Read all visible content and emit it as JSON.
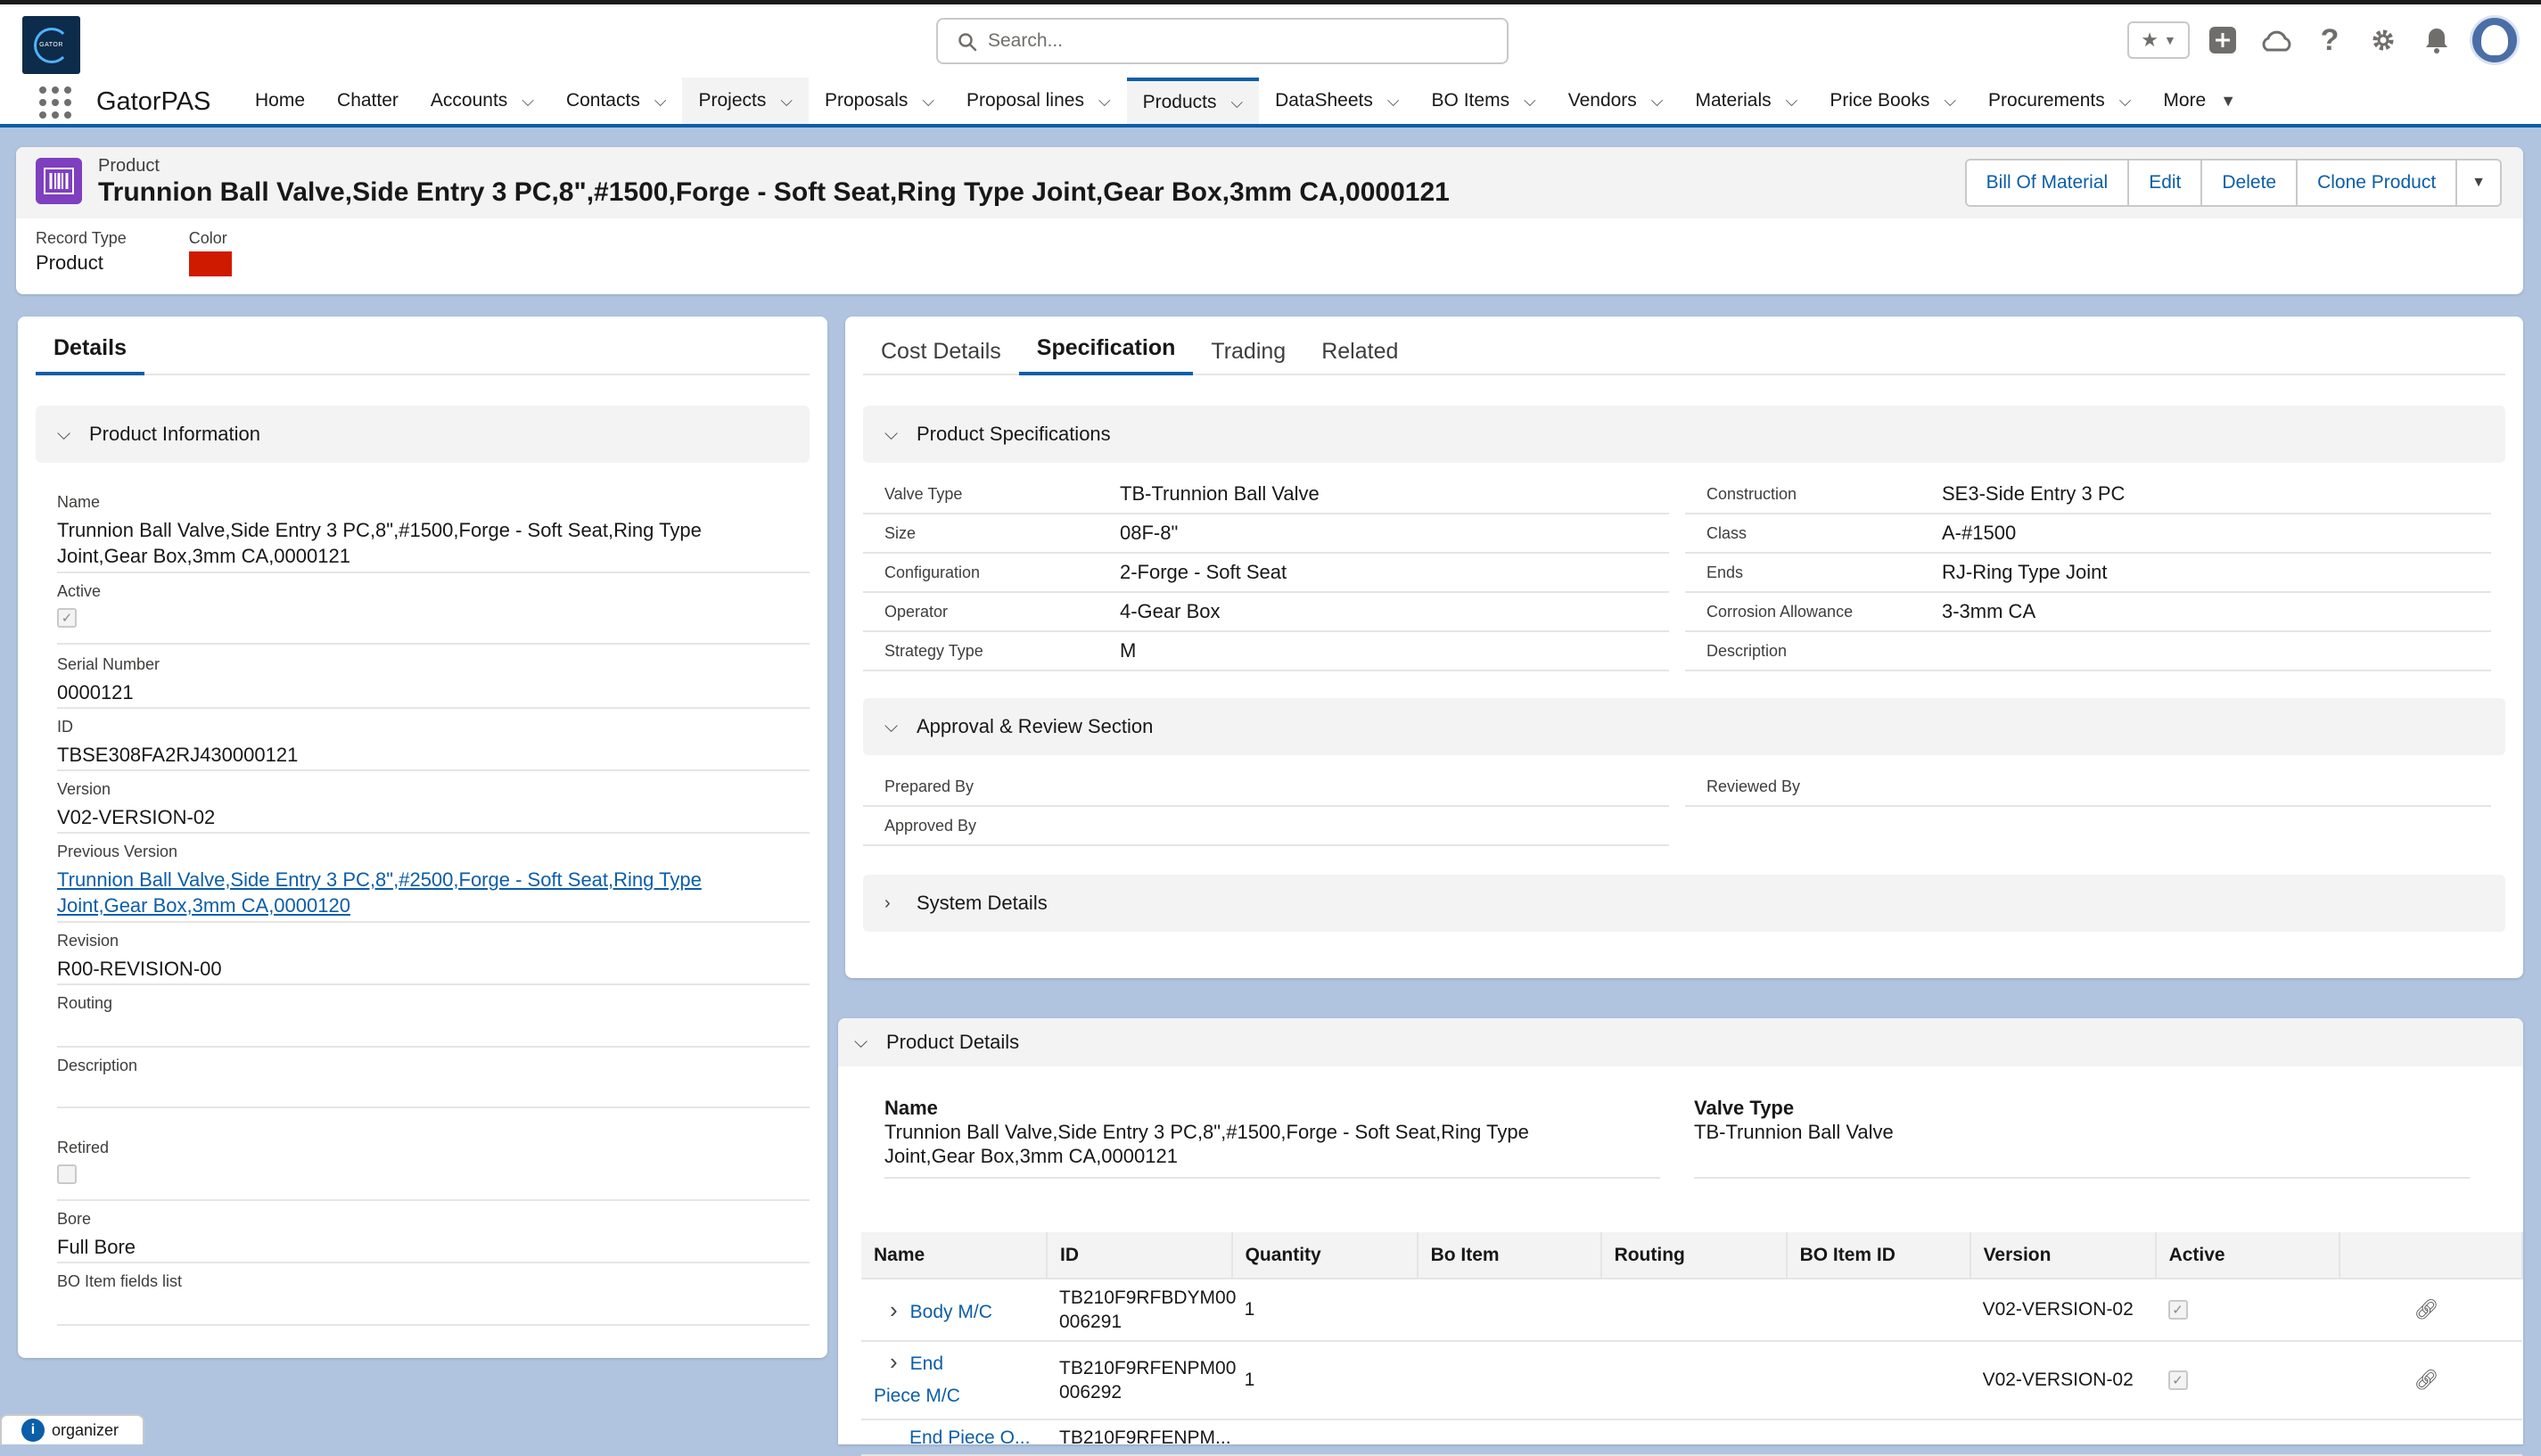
{
  "header": {
    "logo_text": "GATOR",
    "search_placeholder": "Search..."
  },
  "nav": {
    "app_name": "GatorPAS",
    "items": [
      {
        "label": "Home",
        "dropdown": false
      },
      {
        "label": "Chatter",
        "dropdown": false
      },
      {
        "label": "Accounts",
        "dropdown": true
      },
      {
        "label": "Contacts",
        "dropdown": true
      },
      {
        "label": "Projects",
        "dropdown": true
      },
      {
        "label": "Proposals",
        "dropdown": true
      },
      {
        "label": "Proposal lines",
        "dropdown": true
      },
      {
        "label": "Products",
        "dropdown": true
      },
      {
        "label": "DataSheets",
        "dropdown": true
      },
      {
        "label": "BO Items",
        "dropdown": true
      },
      {
        "label": "Vendors",
        "dropdown": true
      },
      {
        "label": "Materials",
        "dropdown": true
      },
      {
        "label": "Price Books",
        "dropdown": true
      },
      {
        "label": "Procurements",
        "dropdown": true
      },
      {
        "label": "More",
        "dropdown": true
      }
    ]
  },
  "highlights": {
    "object_label": "Product",
    "title": "Trunnion Ball Valve,Side Entry 3 PC,8\",#1500,Forge - Soft Seat,Ring Type Joint,Gear Box,3mm CA,0000121",
    "buttons": [
      "Bill Of Material",
      "Edit",
      "Delete",
      "Clone Product"
    ],
    "record_type_label": "Record Type",
    "record_type_value": "Product",
    "color_label": "Color",
    "color_value": "#d01a00"
  },
  "left": {
    "tab": "Details",
    "section": "Product Information",
    "fields": {
      "name_label": "Name",
      "name_value": "Trunnion Ball Valve,Side Entry 3 PC,8\",#1500,Forge - Soft Seat,Ring Type Joint,Gear Box,3mm CA,0000121",
      "active_label": "Active",
      "serial_label": "Serial Number",
      "serial_value": "0000121",
      "id_label": "ID",
      "id_value": "TBSE308FA2RJ430000121",
      "version_label": "Version",
      "version_value": "V02-VERSION-02",
      "prev_label": "Previous Version",
      "prev_value": "Trunnion Ball Valve,Side Entry 3 PC,8\",#2500,Forge - Soft Seat,Ring Type Joint,Gear Box,3mm CA,0000120",
      "revision_label": "Revision",
      "revision_value": "R00-REVISION-00",
      "routing_label": "Routing",
      "description_label": "Description",
      "retired_label": "Retired",
      "bore_label": "Bore",
      "bore_value": "Full Bore",
      "bo_fields_label": "BO Item fields list"
    }
  },
  "right": {
    "tabs": [
      "Cost Details",
      "Specification",
      "Trading",
      "Related"
    ],
    "spec_section": "Product Specifications",
    "spec_left": [
      {
        "label": "Valve Type",
        "value": "TB-Trunnion Ball Valve"
      },
      {
        "label": "Size",
        "value": "08F-8\""
      },
      {
        "label": "Configuration",
        "value": "2-Forge - Soft Seat"
      },
      {
        "label": "Operator",
        "value": "4-Gear Box"
      },
      {
        "label": "Strategy Type",
        "value": "M"
      }
    ],
    "spec_right": [
      {
        "label": "Construction",
        "value": "SE3-Side Entry 3 PC"
      },
      {
        "label": "Class",
        "value": "A-#1500"
      },
      {
        "label": "Ends",
        "value": "RJ-Ring Type Joint"
      },
      {
        "label": "Corrosion Allowance",
        "value": "3-3mm CA"
      },
      {
        "label": "Description",
        "value": ""
      }
    ],
    "approval_section": "Approval & Review Section",
    "prepared_by": "Prepared By",
    "reviewed_by": "Reviewed By",
    "approved_by": "Approved By",
    "system_section": "System Details"
  },
  "product_details": {
    "section": "Product Details",
    "name_label": "Name",
    "name_value": "Trunnion Ball Valve,Side Entry 3 PC,8\",#1500,Forge - Soft Seat,Ring Type Joint,Gear Box,3mm CA,0000121",
    "valve_label": "Valve Type",
    "valve_value": "TB-Trunnion Ball Valve",
    "columns": [
      "Name",
      "ID",
      "Quantity",
      "Bo Item",
      "Routing",
      "BO Item ID",
      "Version",
      "Active"
    ],
    "rows": [
      {
        "name": "Body M/C",
        "id": "TB210F9RFBDYM00 006291",
        "quantity": "1",
        "version": "V02-VERSION-02"
      },
      {
        "name": "End Piece M/C",
        "id": "TB210F9RFENPM00 006292",
        "quantity": "1",
        "version": "V02-VERSION-02"
      },
      {
        "name": "End Piece O...",
        "id": "TB210F9RFENPM...",
        "quantity": "",
        "version": ""
      }
    ]
  },
  "footer": {
    "organizer_label": "organizer"
  }
}
